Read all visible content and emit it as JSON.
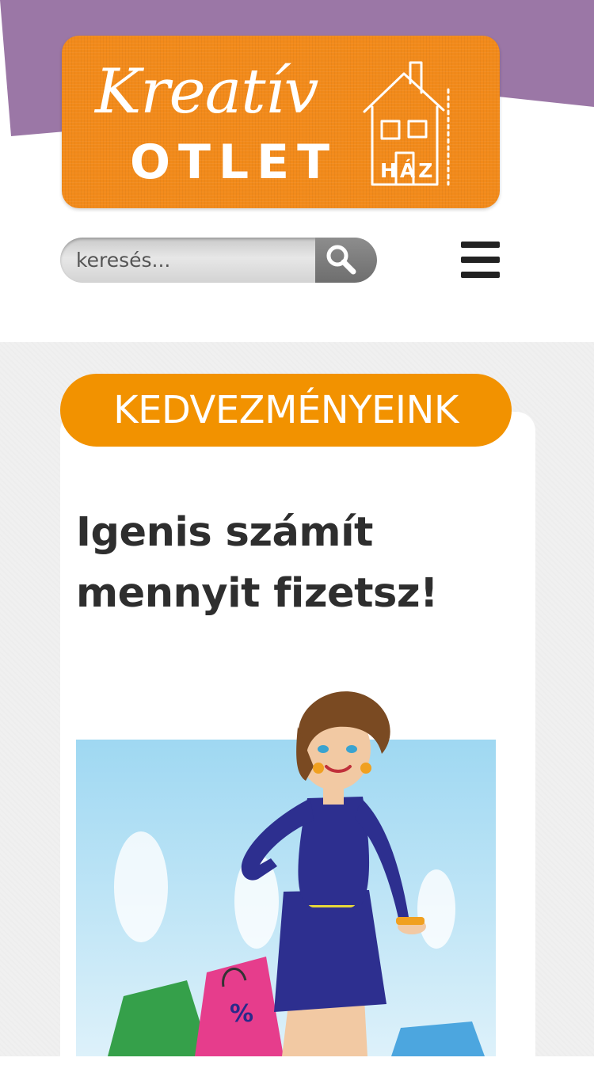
{
  "header": {
    "logo": {
      "script_text": "Kreatív",
      "word_text": "OTLET",
      "small_text": "HÁZ"
    },
    "search": {
      "placeholder": "keresés..."
    },
    "menu_icon": "hamburger-icon"
  },
  "promo": {
    "badge": "KEDVEZMÉNYEINK",
    "headline": "Igenis számít mennyit fizetsz!"
  },
  "colors": {
    "purple_band": "#9b77a6",
    "logo_orange": "#f28a1a",
    "badge_orange": "#f29200",
    "headline_text": "#2e2e2e",
    "content_bg": "#f0f0f0"
  }
}
